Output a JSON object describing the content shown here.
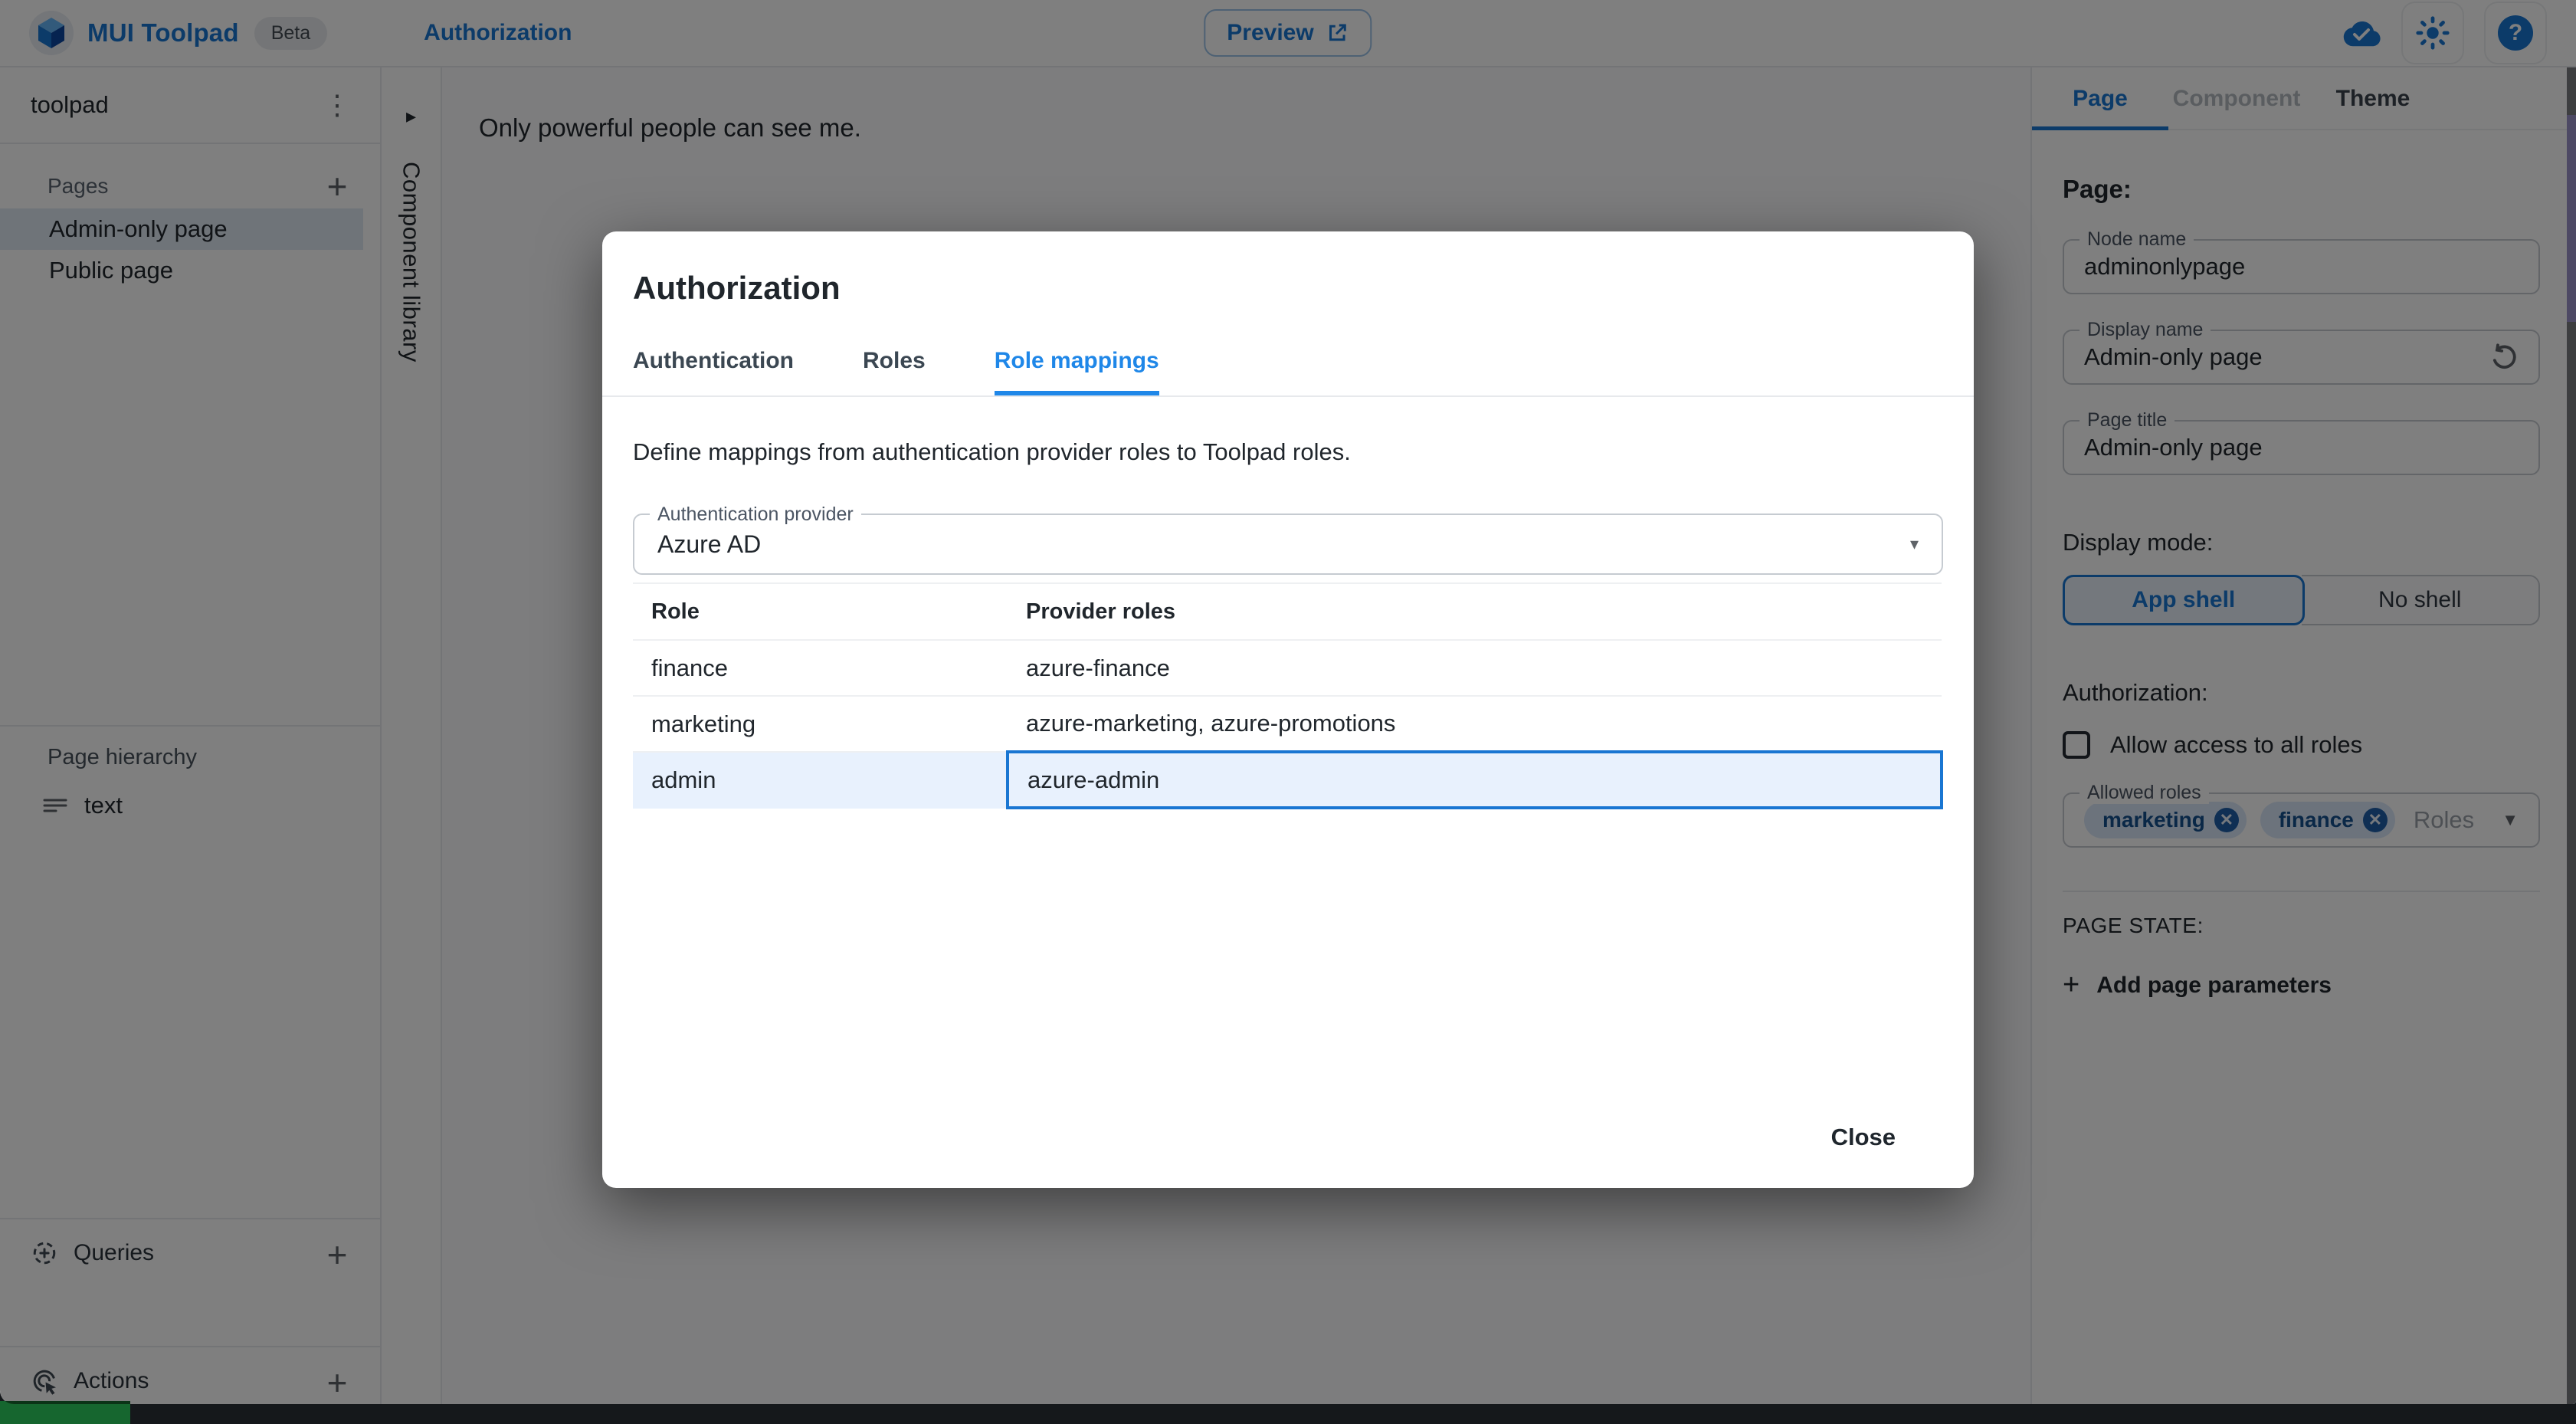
{
  "header": {
    "app_title": "MUI Toolpad",
    "beta_label": "Beta",
    "breadcrumb": "Authorization",
    "preview_label": "Preview"
  },
  "sidebar": {
    "project_name": "toolpad",
    "kebab_glyph": "⋮",
    "plus_glyph": "+",
    "pages_section": {
      "title": "Pages",
      "items": [
        {
          "label": "Admin-only page",
          "selected": true
        },
        {
          "label": "Public page",
          "selected": false
        }
      ]
    },
    "hierarchy_section": {
      "title": "Page hierarchy",
      "items": [
        {
          "label": "text"
        }
      ]
    },
    "queries_section": {
      "title": "Queries"
    },
    "actions_section": {
      "title": "Actions"
    }
  },
  "component_library": {
    "label": "Component library",
    "collapse_glyph": "▸"
  },
  "canvas": {
    "text": "Only powerful people can see me."
  },
  "dialog": {
    "title": "Authorization",
    "tabs": [
      {
        "label": "Authentication",
        "active": false
      },
      {
        "label": "Roles",
        "active": false
      },
      {
        "label": "Role mappings",
        "active": true
      }
    ],
    "description": "Define mappings from authentication provider roles to Toolpad roles.",
    "provider_field": {
      "label": "Authentication provider",
      "value": "Azure AD",
      "arrow_glyph": "▾"
    },
    "table": {
      "columns": [
        "Role",
        "Provider roles"
      ],
      "rows": [
        {
          "role": "finance",
          "provider_roles": "azure-finance",
          "selected": false
        },
        {
          "role": "marketing",
          "provider_roles": "azure-marketing, azure-promotions",
          "selected": false
        },
        {
          "role": "admin",
          "provider_roles": "azure-admin",
          "selected": true
        }
      ]
    },
    "close_label": "Close"
  },
  "inspector": {
    "tabs": [
      {
        "label": "Page",
        "active": true
      },
      {
        "label": "Component",
        "active": false
      },
      {
        "label": "Theme",
        "active": false
      }
    ],
    "heading": "Page:",
    "fields": {
      "node_name": {
        "label": "Node name",
        "value": "adminonlypage"
      },
      "display_name": {
        "label": "Display name",
        "value": "Admin-only page"
      },
      "page_title": {
        "label": "Page title",
        "value": "Admin-only page"
      }
    },
    "display_mode": {
      "label": "Display mode:",
      "options": [
        {
          "label": "App shell",
          "selected": true
        },
        {
          "label": "No shell",
          "selected": false
        }
      ]
    },
    "authorization": {
      "label": "Authorization:",
      "checkbox_label": "Allow access to all roles",
      "checked": false,
      "allowed_roles": {
        "label": "Allowed roles",
        "chips": [
          "marketing",
          "finance"
        ],
        "chip_remove_glyph": "✕",
        "placeholder": "Roles",
        "arrow_glyph": "▼"
      }
    },
    "page_state": {
      "label": "PAGE STATE:",
      "add_button": "Add page parameters",
      "plus_glyph": "+"
    }
  },
  "colors": {
    "primary": "#1976d2",
    "active_tab_blue": "#1f87e8",
    "selected_row_bg": "#e8f1fd",
    "chip_bg": "#d9e7f9",
    "backdrop": "rgba(0,0,0,0.5)"
  }
}
